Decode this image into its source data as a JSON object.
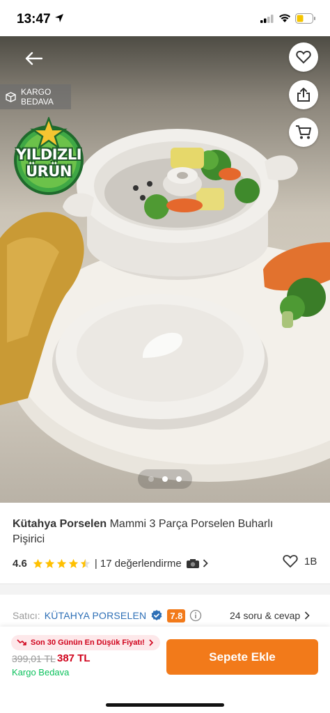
{
  "status_bar": {
    "time": "13:47"
  },
  "hero": {
    "kargo_badge": {
      "line1": "KARGO",
      "line2": "BEDAVA"
    },
    "star_badge": {
      "line1": "YILDIZLI",
      "line2": "ÜRÜN"
    },
    "carousel": {
      "count": 3,
      "active_index": 2
    }
  },
  "product": {
    "brand": "Kütahya Porselen",
    "name": " Mammi 3 Parça Porselen Buharlı Pişirici",
    "rating": "4.6",
    "rating_stars": 4.5,
    "reviews_text": "| 17 değerlendirme",
    "likes": "1B"
  },
  "seller": {
    "label": "Satıcı:",
    "name": "KÜTAHYA PORSELEN",
    "score": "7.8",
    "qa_text": "24 soru & cevap"
  },
  "purchase": {
    "low_price_text": "Son 30 Günün En Düşük Fiyatı!",
    "old_price": "399,01 TL",
    "new_price": "387 TL",
    "shipping": "Kargo Bedava",
    "add_to_cart": "Sepete Ekle"
  },
  "colors": {
    "accent": "#f27a1a",
    "seller_blue": "#2d6fb6",
    "price_red": "#d0021b",
    "free_green": "#0bc15c"
  }
}
